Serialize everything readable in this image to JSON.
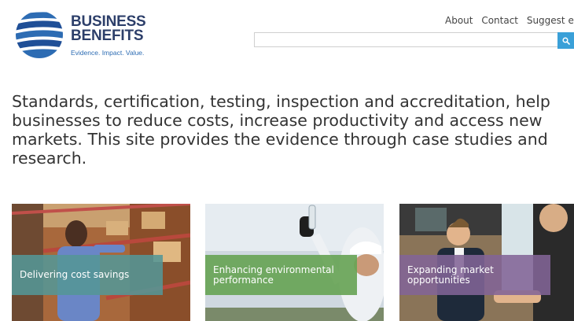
{
  "brand": {
    "line1": "BUSINESS",
    "line2": "BENEFITS",
    "tagline": "Evidence. Impact. Value."
  },
  "nav": {
    "items": [
      {
        "label": "About"
      },
      {
        "label": "Contact"
      },
      {
        "label": "Suggest entr"
      }
    ]
  },
  "search": {
    "value": "",
    "placeholder": "",
    "button_icon": "search-icon"
  },
  "intro": {
    "text": "Standards, certification, testing, inspection and accreditation, help businesses to reduce costs, increase productivity and access new markets. This site provides the evidence through case studies and research."
  },
  "cards": [
    {
      "label": "Delivering cost savings"
    },
    {
      "label": "Enhancing environmental performance"
    },
    {
      "label": "Expanding market opportunities"
    }
  ],
  "colors": {
    "brand_navy": "#2d3f6a",
    "brand_blue": "#2d6cb3",
    "search_button": "#3aa0d8",
    "card1_overlay": "#5a9696",
    "card2_overlay": "#68a456",
    "card3_overlay": "#826496"
  }
}
